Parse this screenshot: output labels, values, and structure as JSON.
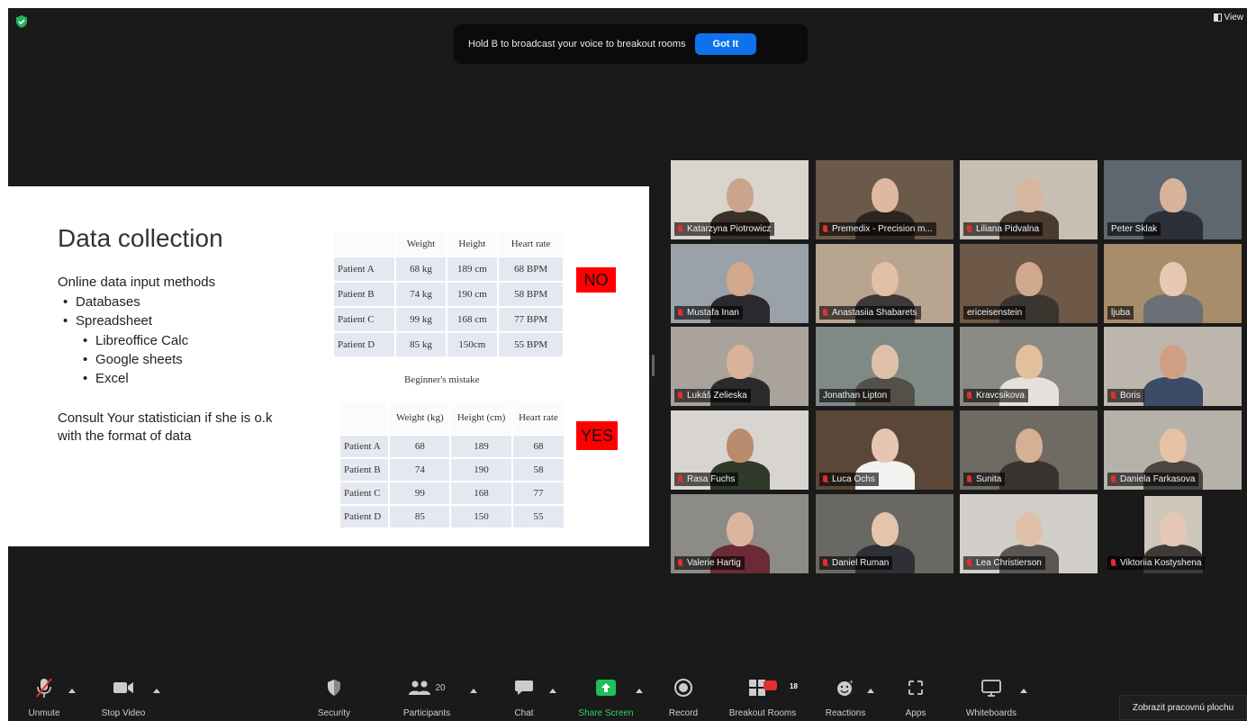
{
  "window": {
    "view_label": "View"
  },
  "broadcast": {
    "message": "Hold B to broadcast your voice to breakout rooms",
    "button": "Got It"
  },
  "slide": {
    "title": "Data collection",
    "subtitle": "Online data input methods",
    "bullets": [
      "Databases",
      "Spreadsheet",
      "Libreoffice Calc",
      "Google sheets",
      "Excel"
    ],
    "consult": "Consult Your statistician if she is o.k with the format of data",
    "table1": {
      "headers": [
        "",
        "Weight",
        "Height",
        "Heart rate"
      ],
      "rows": [
        [
          "Patient A",
          "68 kg",
          "189 cm",
          "68 BPM"
        ],
        [
          "Patient B",
          "74 kg",
          "190 cm",
          "58 BPM"
        ],
        [
          "Patient C",
          "99 kg",
          "168 cm",
          "77 BPM"
        ],
        [
          "Patient D",
          "85 kg",
          "150cm",
          "55 BPM"
        ]
      ]
    },
    "caption": "Beginner's mistake",
    "table2": {
      "headers": [
        "",
        "Weight (kg)",
        "Height (cm)",
        "Heart rate"
      ],
      "rows": [
        [
          "Patient A",
          "68",
          "189",
          "68"
        ],
        [
          "Patient B",
          "74",
          "190",
          "58"
        ],
        [
          "Patient C",
          "99",
          "168",
          "77"
        ],
        [
          "Patient D",
          "85",
          "150",
          "55"
        ]
      ]
    },
    "flag_no": "NO",
    "flag_yes": "YES"
  },
  "participants": [
    {
      "name": "Katarzyna Piotrowicz",
      "muted": true
    },
    {
      "name": "Premedix - Precision m...",
      "muted": true
    },
    {
      "name": "Liliana Pidvalna",
      "muted": true
    },
    {
      "name": "Peter Sklak",
      "muted": false,
      "active": true
    },
    {
      "name": "Mustafa Inan",
      "muted": true
    },
    {
      "name": "Anastasiia Shabarets",
      "muted": true
    },
    {
      "name": "ericeisenstein",
      "muted": false
    },
    {
      "name": "ljuba",
      "muted": false
    },
    {
      "name": "Lukáš Zelieska",
      "muted": true
    },
    {
      "name": "Jonathan Lipton",
      "muted": false
    },
    {
      "name": "Kravcsikova",
      "muted": true
    },
    {
      "name": "Boris",
      "muted": true
    },
    {
      "name": "Rasa Fuchs",
      "muted": true
    },
    {
      "name": "Luca Ochs",
      "muted": true
    },
    {
      "name": "Sunita",
      "muted": true
    },
    {
      "name": "Daniela Farkasova",
      "muted": true
    },
    {
      "name": "Valerie Hartig",
      "muted": true
    },
    {
      "name": "Daniel Ruman",
      "muted": true
    },
    {
      "name": "Lea Christierson",
      "muted": true
    },
    {
      "name": "Viktoriia Kostyshena",
      "muted": true
    }
  ],
  "toolbar": {
    "unmute": "Unmute",
    "stop_video": "Stop Video",
    "security": "Security",
    "participants": "Participants",
    "participant_count": "20",
    "chat": "Chat",
    "share_screen": "Share Screen",
    "record": "Record",
    "breakout_rooms": "Breakout Rooms",
    "breakout_count": "18",
    "reactions": "Reactions",
    "apps": "Apps",
    "whiteboards": "Whiteboards",
    "show_desktop": "Zobrazit pracovnú plochu"
  },
  "colors": {
    "accent": "#0e72ed",
    "share": "#2fd069",
    "muted": "#e0302f",
    "active_speaker": "#d5e83b",
    "flag": "#ff0000"
  }
}
